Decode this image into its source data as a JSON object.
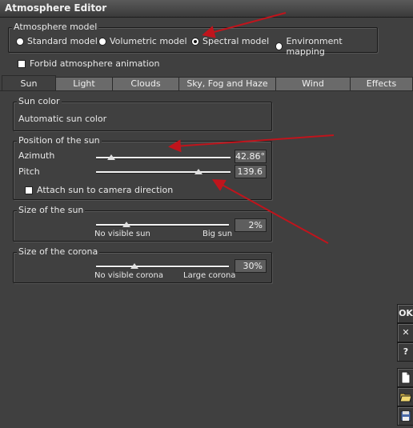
{
  "window": {
    "title": "Atmosphere Editor"
  },
  "atmosphere_model": {
    "legend": "Atmosphere model",
    "options": [
      {
        "label": "Standard model",
        "selected": false
      },
      {
        "label": "Volumetric model",
        "selected": false
      },
      {
        "label": "Spectral model",
        "selected": true
      },
      {
        "label": "Environment mapping",
        "selected": false
      }
    ]
  },
  "forbid_animation": {
    "label": "Forbid atmosphere animation",
    "checked": false
  },
  "tabs": [
    {
      "label": "Sun",
      "active": true
    },
    {
      "label": "Light",
      "active": false
    },
    {
      "label": "Clouds",
      "active": false
    },
    {
      "label": "Sky, Fog and Haze",
      "active": false
    },
    {
      "label": "Wind",
      "active": false
    },
    {
      "label": "Effects",
      "active": false
    }
  ],
  "sun_color": {
    "legend": "Sun color",
    "value": "Automatic sun color"
  },
  "position": {
    "legend": "Position of the sun",
    "azimuth": {
      "label": "Azimuth",
      "value": "42.86°",
      "level": 0.12
    },
    "pitch": {
      "label": "Pitch",
      "value": "139.6",
      "level": 0.78
    },
    "attach": {
      "label": "Attach sun to camera direction",
      "checked": false
    }
  },
  "sun_size": {
    "legend": "Size of the sun",
    "value": "2%",
    "level": 0.25,
    "min_label": "No visible sun",
    "max_label": "Big sun"
  },
  "corona_size": {
    "legend": "Size of the corona",
    "value": "30%",
    "level": 0.3,
    "min_label": "No visible corona",
    "max_label": "Large corona"
  },
  "side_buttons": {
    "ok": "OK",
    "close": "✕",
    "help": "?"
  },
  "icons": [
    "new-document-icon",
    "open-folder-icon",
    "save-disk-icon"
  ],
  "colors": {
    "background": "#404040",
    "annotation_arrow": "#c0141c"
  }
}
